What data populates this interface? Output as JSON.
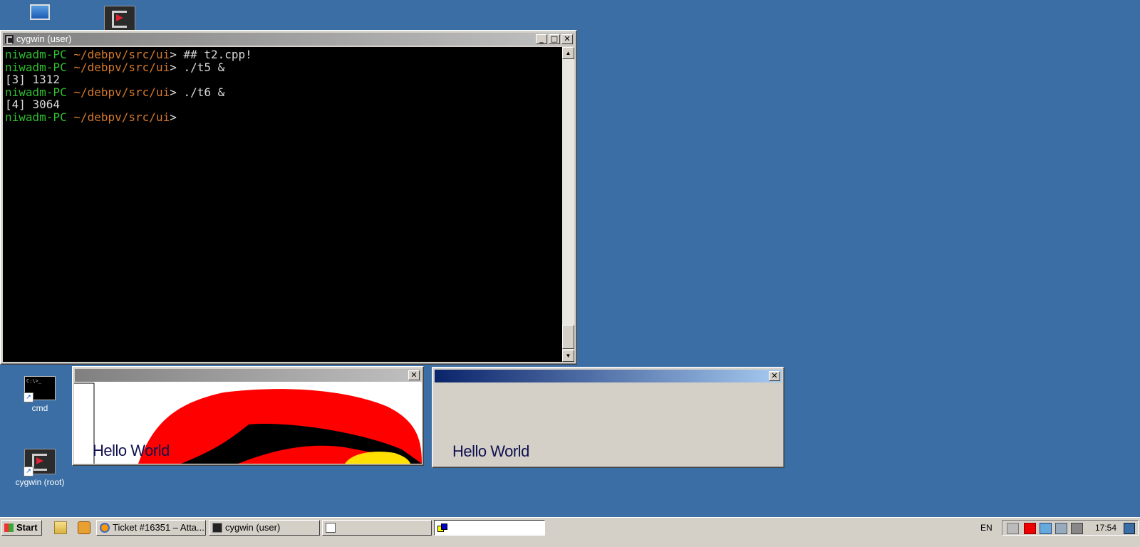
{
  "desktop": {
    "icons": [
      {
        "label": "cmd"
      },
      {
        "label": "cygwin (root)"
      }
    ]
  },
  "terminal_window": {
    "title": "cygwin (user)",
    "lines": [
      {
        "host": "niwadm-PC",
        "path": "~/debpv/src/ui",
        "cmd": "> ## t2.cpp!"
      },
      {
        "host": "niwadm-PC",
        "path": "~/debpv/src/ui",
        "cmd": "> ./t5 &"
      },
      {
        "output": "[3] 1312"
      },
      {
        "host": "niwadm-PC",
        "path": "~/debpv/src/ui",
        "cmd": "> ./t6 &"
      },
      {
        "output": "[4] 3064"
      },
      {
        "host": "niwadm-PC",
        "path": "~/debpv/src/ui",
        "cmd": ">"
      }
    ],
    "buttons": {
      "minimize": "_",
      "maximize": "□",
      "close": "✕"
    }
  },
  "window_t5": {
    "title": "",
    "text": "Hello World",
    "close": "✕"
  },
  "window_t6": {
    "title": "",
    "text": "Hello World",
    "close": "✕"
  },
  "taskbar": {
    "start_label": "Start",
    "buttons": [
      {
        "label": "Ticket #16351 – Atta..."
      },
      {
        "label": "cygwin (user)"
      },
      {
        "label": ""
      },
      {
        "label": ""
      }
    ],
    "language": "EN",
    "clock": "17:54"
  },
  "colors": {
    "desktop": "#3a6ea5",
    "prompt_host": "#2fbf2f",
    "prompt_path": "#d4782a",
    "shape_red": "#ff0000",
    "shape_yellow": "#ffe000",
    "hello_text": "#101050"
  }
}
